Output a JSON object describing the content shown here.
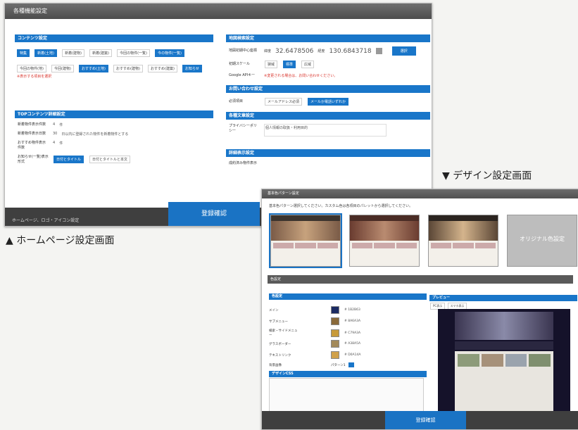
{
  "homepage_settings": {
    "window_title": "各種機能設定",
    "contents": {
      "title": "コンテンツ設定",
      "row1": [
        "特集",
        "新着(土地)",
        "新着(建物)",
        "新着(建築)",
        "今回の物件(一覧)",
        "今の物件(一覧)"
      ],
      "row2": [
        "今回の物件(地)",
        "今回(建物)",
        "おすすめ(土地)",
        "おすすめ(建物)",
        "おすすめ(建築)",
        "お知らせ"
      ],
      "note": "※表示する項目を選択"
    },
    "map": {
      "title": "地図検索設定",
      "center_label": "地図初期中心座標",
      "lat_label": "緯度",
      "lat": "32.6478506",
      "lng_label": "経度",
      "lng": "130.6843718",
      "btn": "選択",
      "scale_label": "初期スケール",
      "scale_opts": [
        "狭域",
        "標準",
        "広域"
      ],
      "apikey_label": "Google APIキー",
      "apikey_note": "※変更される場合は、お問い合わせください。"
    },
    "top_detail": {
      "title": "TOPコンテンツ詳細設定",
      "r1_label": "新着物件表示件数",
      "r1_val": "4",
      "r1_unit": "件",
      "r2_label": "新着物件表示日数",
      "r2_val": "30",
      "r2_desc": "日以内に登録された物件を新着物件とする",
      "r3_label": "おすすめ物件表示件数",
      "r3_val": "4",
      "r3_unit": "件",
      "r4_label": "お知らせ(一覧)表示形式",
      "r4_opts": [
        "日付とタイトル",
        "日付とタイトルと本文"
      ]
    },
    "contact": {
      "title": "お問い合わせ設定",
      "label": "必須項目",
      "opts": [
        "メールアドレス必須",
        "メールか電話いずれか"
      ]
    },
    "text_settings": {
      "title": "各種文章設定",
      "label": "プライバシーポリシー",
      "val": "個人情報の取扱・利用目的"
    },
    "detail_display": {
      "title": "詳細表示設定",
      "label": "成約済み物件表示"
    },
    "bottom_label": "ホームページ、ロゴ・アイコン設定",
    "register_btn": "登録確認"
  },
  "design_settings": {
    "window_title": "基本色パターン設定",
    "intro": "基本色パターン選択してください。カスタム色は各項目のパレットから選択してください。",
    "themes": [
      "",
      "",
      "",
      "オリジナル色設定"
    ],
    "color_section": "色設定",
    "color_sub": "色設定",
    "color_rows": [
      {
        "name": "メイン",
        "hex": "#1b2b63",
        "code": "# 1B2B63"
      },
      {
        "name": "サブメニュー",
        "hex": "#8a6a3a",
        "code": "# 8A6A3A"
      },
      {
        "name": "検索・サイドメニュー",
        "hex": "#c79a3a",
        "code": "# C79A3A"
      },
      {
        "name": "グラスボーダー",
        "hex": "#a38a5a",
        "code": "# A38A5A"
      },
      {
        "name": "テキストリンク",
        "hex": "#d0a14a",
        "code": "# D0A14A"
      }
    ],
    "bg_label": "背景画像",
    "bg_btn": "パターン1",
    "design_css": "デザインCSS",
    "preview_label": "プレビュー",
    "preview_tabs": [
      "PC表示",
      "スマホ表示"
    ],
    "register_btn": "登録確認"
  },
  "captions": {
    "homepage": "▲ ホームページ設定画面",
    "design": "▼ デザイン設定画面"
  },
  "colors": {
    "accent": "#1976c9",
    "dark": "#3f3f3f"
  }
}
